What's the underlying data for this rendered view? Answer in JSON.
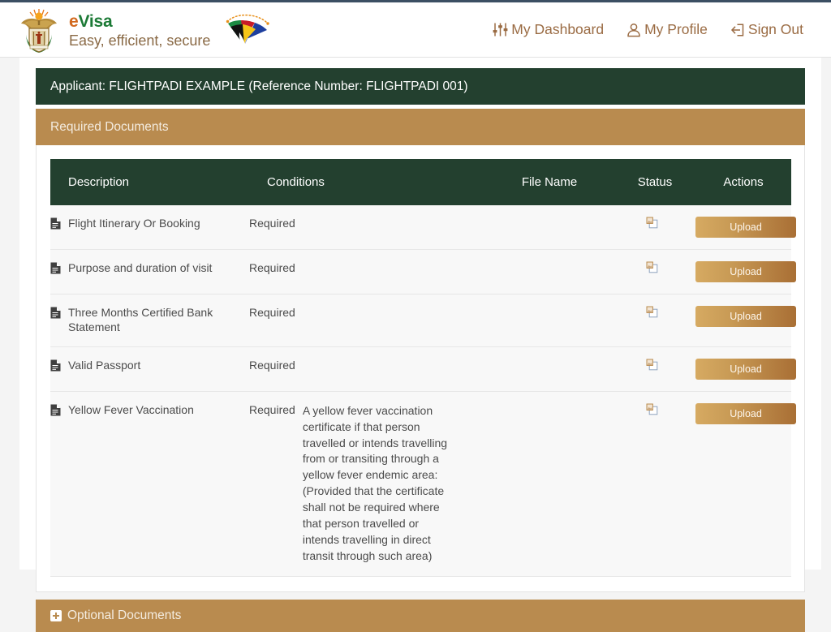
{
  "brand": {
    "coat_of_arms_icon": "south-africa-coat-of-arms",
    "name_e": "e",
    "name_visa": "Visa",
    "tagline": "Easy, efficient, secure",
    "flag_icon": "south-africa-flag-fan"
  },
  "nav": {
    "items": [
      {
        "label": "My Dashboard",
        "icon": "sliders-icon"
      },
      {
        "label": "My Profile",
        "icon": "user-icon"
      },
      {
        "label": "Sign Out",
        "icon": "sign-out-icon"
      }
    ]
  },
  "applicant": {
    "bar_text": "Applicant: FLIGHTPADI EXAMPLE (Reference Number: FLIGHTPADI 001)",
    "name": "FLIGHTPADI EXAMPLE",
    "reference_number": "FLIGHTPADI 001"
  },
  "required_section": {
    "title": "Required Documents",
    "columns": [
      "Description",
      "Conditions",
      "File Name",
      "Status",
      "Actions"
    ],
    "rows": [
      {
        "description": "Flight Itinerary Or Booking",
        "condition": "Required",
        "condition_note": "",
        "file_name": "",
        "status_icon": "broken-image-icon",
        "action_label": "Upload",
        "doc_icon": "document-icon"
      },
      {
        "description": "Purpose and duration of visit",
        "condition": "Required",
        "condition_note": "",
        "file_name": "",
        "status_icon": "broken-image-icon",
        "action_label": "Upload",
        "doc_icon": "document-icon"
      },
      {
        "description": "Three Months Certified Bank Statement",
        "condition": "Required",
        "condition_note": "",
        "file_name": "",
        "status_icon": "broken-image-icon",
        "action_label": "Upload",
        "doc_icon": "document-icon"
      },
      {
        "description": "Valid Passport",
        "condition": "Required",
        "condition_note": "",
        "file_name": "",
        "status_icon": "broken-image-icon",
        "action_label": "Upload",
        "doc_icon": "document-icon"
      },
      {
        "description": "Yellow Fever Vaccination",
        "condition": "Required",
        "condition_note": "A yellow fever vaccination certificate if that person travelled or intends travelling from or transiting through a yellow fever endemic area: (Provided that the certificate shall not be required where that person travelled or intends travelling in direct transit through such area)",
        "file_name": "",
        "status_icon": "broken-image-icon",
        "action_label": "Upload",
        "doc_icon": "document-icon"
      }
    ]
  },
  "optional_section": {
    "title": "Optional Documents",
    "expand_icon": "plus-icon"
  },
  "colors": {
    "dark_green": "#23402f",
    "gold": "#b98b4f",
    "brand_orange": "#d2691e",
    "brand_green": "#1c7a36",
    "nav_brown": "#9a6b43",
    "row_background": "#f8f8f8"
  }
}
